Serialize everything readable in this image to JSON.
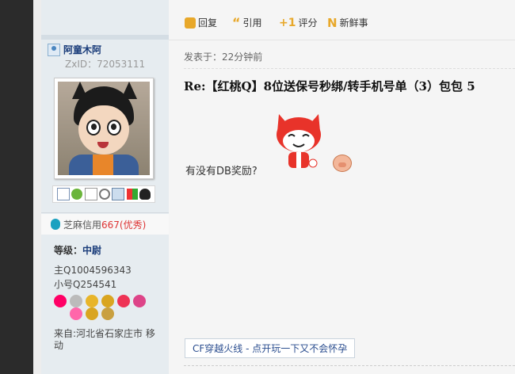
{
  "toolbar": {
    "reply": "回复",
    "quote": "引用",
    "rate": "评分",
    "news": "新鲜事"
  },
  "user": {
    "name": "阿童木阿",
    "zxid": "ZxID：72053111",
    "credit_label": "芝麻信用",
    "credit_score": "667(优秀)",
    "level_label": "等级：",
    "level_value": "中尉",
    "info_main": "主Q1004596343",
    "info_alt": "小号Q254541",
    "from": "来自:河北省石家庄市 移动"
  },
  "post": {
    "posted": "发表于：22分钟前",
    "title": "Re:【红桃Q】8位送保号秒绑/转手机号单（3）包包 5",
    "body": "有没有DB奖励?",
    "ad": "CF穿越火线 - 点开玩一下又不会怀孕"
  },
  "colors": {
    "accent": "#e8a82a",
    "link": "#1a3c7a",
    "credit": "#d33"
  }
}
